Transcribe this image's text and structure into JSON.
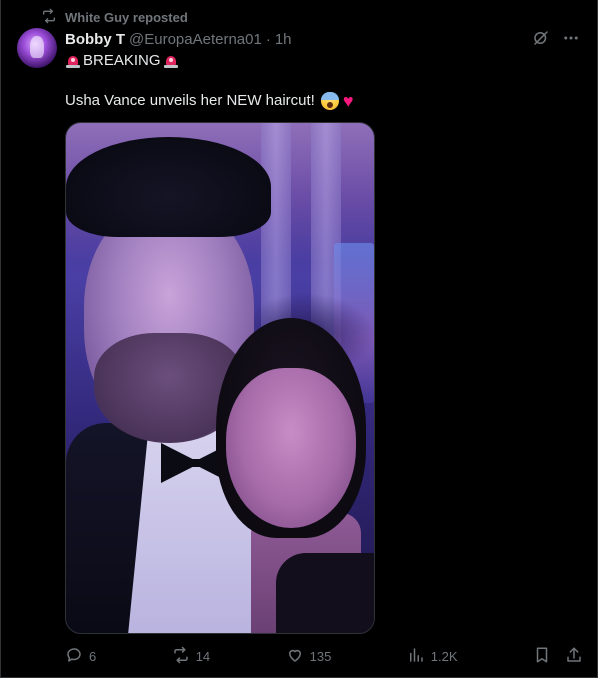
{
  "repost": {
    "label": "White Guy reposted",
    "icon": "repost-icon"
  },
  "author": {
    "name": "Bobby T",
    "handle": "@EuropaAeterna01",
    "separator": "·",
    "time": "1h"
  },
  "post": {
    "line1": "BREAKING",
    "line2": "Usha Vance unveils her NEW haircut!",
    "emojis": [
      "rotating-light",
      "face-screaming-in-fear",
      "red-heart"
    ]
  },
  "metrics": {
    "replies": "6",
    "reposts": "14",
    "likes": "135",
    "views": "1.2K"
  },
  "icons": {
    "reply": "reply-icon",
    "repost": "repost-icon",
    "like": "heart-icon",
    "views": "views-bar-icon",
    "bookmark": "bookmark-icon",
    "share": "share-icon",
    "grok": "grok-icon",
    "more": "more-icon"
  },
  "colors": {
    "background": "#000000",
    "text": "#e7e9ea",
    "muted": "#71767b",
    "border": "#2f3336"
  }
}
